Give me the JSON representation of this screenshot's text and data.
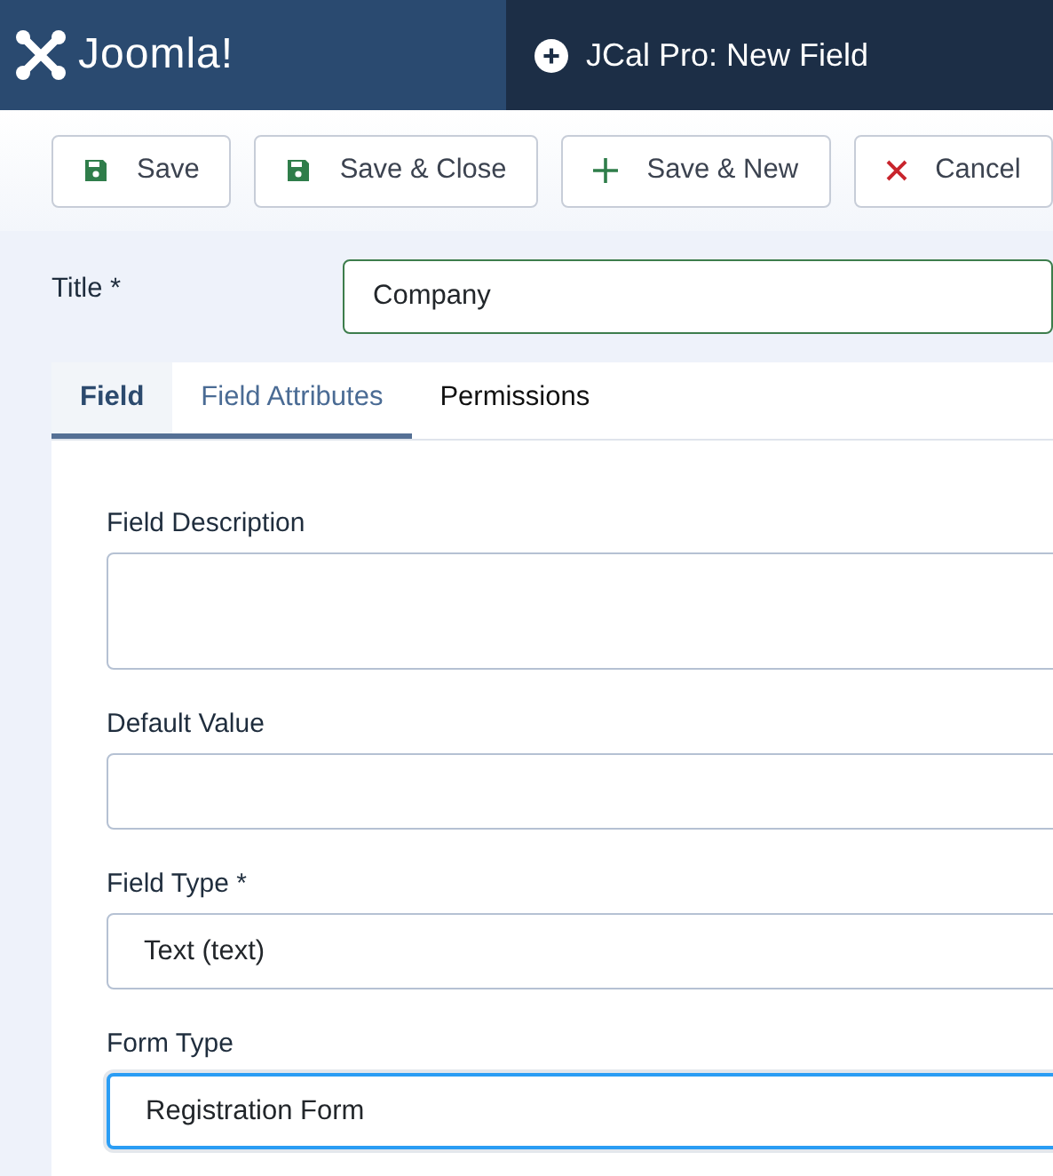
{
  "header": {
    "logo": "Joomla!",
    "title": "JCal Pro: New Field"
  },
  "toolbar": [
    {
      "label": "Save",
      "kind": "save"
    },
    {
      "label": "Save & Close",
      "kind": "save"
    },
    {
      "label": "Save & New",
      "kind": "add"
    },
    {
      "label": "Cancel",
      "kind": "cancel"
    }
  ],
  "title_field": {
    "label": "Title *",
    "value": "Company",
    "valid": true
  },
  "tabs": [
    {
      "label": "Field",
      "selected": true,
      "hovered": false
    },
    {
      "label": "Field Attributes",
      "selected": false,
      "hovered": true
    },
    {
      "label": "Permissions",
      "selected": false,
      "hovered": false
    }
  ],
  "fields": [
    {
      "label": "Field Description",
      "kind": "textarea",
      "focused": false
    },
    {
      "label": "Default Value",
      "kind": "text",
      "focused": false
    },
    {
      "label": "Field Type *",
      "kind": "select",
      "value": "Text (text)",
      "focused": false
    },
    {
      "label": "Form Type",
      "kind": "select",
      "value": "Registration Form",
      "focused": true
    }
  ]
}
